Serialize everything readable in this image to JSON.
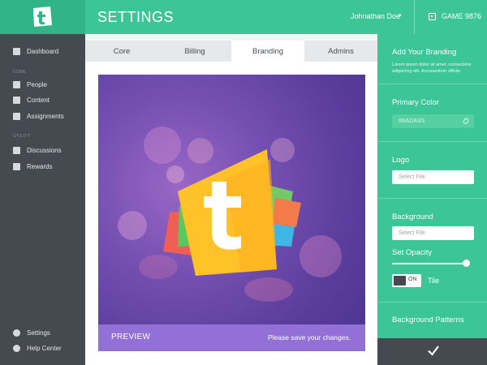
{
  "app": {
    "title": "SETTINGS"
  },
  "header": {
    "user_name": "Johnathan Doe",
    "caret": "▾",
    "game_label": "GAME 9876"
  },
  "sidebar": {
    "items": [
      {
        "label": "Dashboard",
        "icon": "dashboard-icon"
      },
      {
        "label": "People",
        "icon": "people-icon"
      },
      {
        "label": "Content",
        "icon": "content-icon"
      },
      {
        "label": "Assignments",
        "icon": "assignments-icon"
      },
      {
        "label": "Discussions",
        "icon": "discussions-icon"
      },
      {
        "label": "Rewards",
        "icon": "rewards-icon"
      }
    ],
    "sections": {
      "core": "CORE",
      "utility": "UTILITY"
    },
    "bottom_items": [
      {
        "label": "Settings",
        "icon": "gear-icon"
      },
      {
        "label": "Help Center",
        "icon": "help-icon"
      }
    ]
  },
  "tabs": [
    {
      "label": "Core",
      "active": false
    },
    {
      "label": "Billing",
      "active": false
    },
    {
      "label": "Branding",
      "active": true
    },
    {
      "label": "Admins",
      "active": false
    }
  ],
  "preview": {
    "label": "PREVIEW",
    "note": "Please save your changes."
  },
  "branding": {
    "title": "Add Your Branding",
    "description": "Lorem ipsum dolor sit amet, consectetur adipiscing elit. Accusantium officiis.",
    "primary_color_label": "Primary Color",
    "primary_color_value": "#BADASS",
    "logo_label": "Logo",
    "logo_placeholder": "Select File",
    "background_label": "Background",
    "background_placeholder": "Select File",
    "opacity_label": "Set Opacity",
    "opacity_value": 0.98,
    "tile_toggle_text": "ON",
    "tile_label": "Tile",
    "patterns_label": "Background Patterns"
  },
  "colors": {
    "accent": "#3cc596",
    "sidebar": "#454a51",
    "preview_purple": "#9270d6"
  }
}
